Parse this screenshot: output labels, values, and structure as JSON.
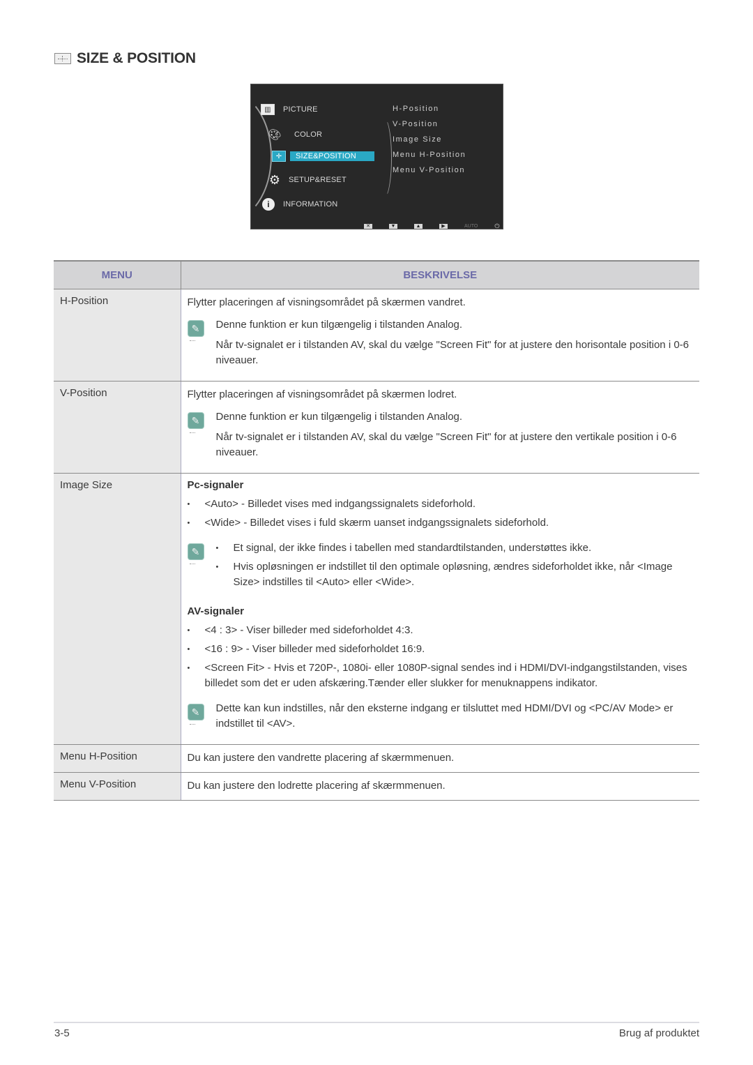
{
  "page": {
    "title": "SIZE & POSITION",
    "title_icon": "size-position-icon"
  },
  "osd": {
    "menu": [
      {
        "label": "PICTURE",
        "icon": "picture-icon",
        "active": false
      },
      {
        "label": "COLOR",
        "icon": "palette-icon",
        "active": false
      },
      {
        "label": "SIZE&POSITION",
        "icon": "size-position-icon",
        "active": true
      },
      {
        "label": "SETUP&RESET",
        "icon": "gear-icon",
        "active": false
      },
      {
        "label": "INFORMATION",
        "icon": "info-icon",
        "active": false
      }
    ],
    "submenu": [
      "H-Position",
      "V-Position",
      "Image Size",
      "Menu H-Position",
      "Menu V-Position"
    ],
    "buttons": {
      "close": "✕",
      "down": "▼",
      "up": "▲",
      "enter": "▶",
      "auto": "AUTO",
      "power": "⏻"
    }
  },
  "table": {
    "headers": {
      "menu": "MENU",
      "description": "BESKRIVELSE"
    },
    "rows": {
      "h_position": {
        "menu": "H-Position",
        "desc": "Flytter placeringen af visningsområdet på skærmen vandret.",
        "notes": [
          "Denne funktion er kun tilgængelig i tilstanden Analog.",
          "Når tv-signalet er i tilstanden AV, skal du vælge \"Screen Fit\" for at justere den horisontale position i 0-6 niveauer."
        ]
      },
      "v_position": {
        "menu": "V-Position",
        "desc": "Flytter placeringen af visningsområdet på skærmen lodret.",
        "notes": [
          "Denne funktion er kun tilgængelig i tilstanden Analog.",
          "Når tv-signalet er i tilstanden AV, skal du vælge \"Screen Fit\" for at justere den vertikale position i 0-6 niveauer."
        ]
      },
      "image_size": {
        "menu": "Image Size",
        "pc_heading": "Pc-signaler",
        "pc_bullets": [
          "<Auto> - Billedet vises med indgangssignalets sideforhold.",
          "<Wide> - Billedet vises i fuld skærm uanset indgangssignalets sideforhold."
        ],
        "pc_notes": [
          "Et signal, der ikke findes i tabellen med standardtilstanden, understøttes ikke.",
          "Hvis opløsningen er indstillet til den optimale opløsning, ændres sideforholdet ikke, når <Image Size> indstilles til <Auto> eller <Wide>."
        ],
        "av_heading": "AV-signaler",
        "av_bullets": [
          "<4 : 3> - Viser billeder med sideforholdet 4:3.",
          "<16 : 9> - Viser billeder med sideforholdet 16:9.",
          "<Screen Fit> - Hvis et 720P-, 1080i- eller 1080P-signal sendes ind i HDMI/DVI-indgangstilstanden, vises billedet som det er uden afskæring.Tænder eller slukker for menuknappens indikator."
        ],
        "av_note": "Dette kan kun indstilles, når den eksterne indgang er tilsluttet med HDMI/DVI og <PC/AV Mode> er indstillet til <AV>."
      },
      "menu_h_position": {
        "menu": "Menu H-Position",
        "desc": "Du kan justere den vandrette placering af skærmmenuen."
      },
      "menu_v_position": {
        "menu": "Menu V-Position",
        "desc": "Du kan justere den lodrette placering af skærmmenuen."
      }
    }
  },
  "footer": {
    "page_number": "3-5",
    "section": "Brug af produktet"
  },
  "colors": {
    "header_text": "#6b6aa8",
    "header_bg": "#d4d4d6",
    "menu_col_bg": "#e8e8e8",
    "note_icon": "#6fa89c",
    "osd_highlight": "#2aa8c4"
  }
}
